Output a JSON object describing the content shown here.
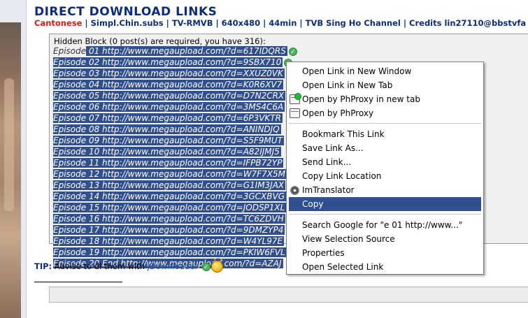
{
  "header": {
    "title": "DIRECT DOWNLOAD LINKS",
    "meta_lang": "Cantonese",
    "meta_rest": " | Simpl.Chin.subs | TV-RMVB | 640x480 | 44min | TVB Sing Ho Channel | Credits lin27110@bbstvfa"
  },
  "quote": {
    "hint": "Hidden Block (0 post(s) are required, you have 316):",
    "rows": [
      {
        "pre": "Episode",
        "sel": " 01 http://www.megaupload.com/?d=617IDQRS",
        "check": true
      },
      {
        "pre": "",
        "sel": "Episode 02 http://www.megaupload.com/?d=9SBX710",
        "check": true
      },
      {
        "pre": "",
        "sel": "Episode 03 http://www.megaupload.com/?d=XXUZ0VK",
        "check": false
      },
      {
        "pre": "",
        "sel": "Episode 04 http://www.megaupload.com/?d=K0R6XV7",
        "check": false
      },
      {
        "pre": "",
        "sel": "Episode 05 http://www.megaupload.com/?d=D7N2CRX",
        "check": false
      },
      {
        "pre": "",
        "sel": "Episode 06 http://www.megaupload.com/?d=3MS4C6A",
        "check": false
      },
      {
        "pre": "",
        "sel": "Episode 07 http://www.megaupload.com/?d=6P3VKTR",
        "check": false
      },
      {
        "pre": "",
        "sel": "Episode 08 http://www.megaupload.com/?d=ANINDJQ",
        "check": false
      },
      {
        "pre": "",
        "sel": "Episode 09 http://www.megaupload.com/?d=S5F9MUT",
        "check": false
      },
      {
        "pre": "",
        "sel": "Episode 10 http://www.megaupload.com/?d=A82IJMJ5",
        "check": false
      },
      {
        "pre": "",
        "sel": "Episode 11 http://www.megaupload.com/?d=IFPB72YP",
        "check": false
      },
      {
        "pre": "",
        "sel": "Episode 12 http://www.megaupload.com/?d=W7F7X5M",
        "check": false
      },
      {
        "pre": "",
        "sel": "Episode 13 http://www.megaupload.com/?d=G1IM3JAX",
        "check": false
      },
      {
        "pre": "",
        "sel": "Episode 14 http://www.megaupload.com/?d=3GCXBVG",
        "check": false
      },
      {
        "pre": "",
        "sel": "Episode 15 http://www.megaupload.com/?d=JODSP1XL",
        "check": false
      },
      {
        "pre": "",
        "sel": "Episode 16 http://www.megaupload.com/?d=TC6ZDVH",
        "check": false
      },
      {
        "pre": "",
        "sel": "Episode 17 http://www.megaupload.com/?d=9DMZYP4",
        "check": false
      },
      {
        "pre": "",
        "sel": "Episode 18 http://www.megaupload.com/?d=W4YL97E",
        "check": false
      },
      {
        "pre": "",
        "sel": "Episode 19 http://www.megaupload.com/?d=PKIW6FVL",
        "check": false
      },
      {
        "pre": "",
        "sel": "Episode 20 End http://www.megaupload.com/?d=AZAJ",
        "check": false
      }
    ]
  },
  "tip": {
    "label": "TIP:",
    "text": " Advise to dl them with ",
    "link": "JDownloader"
  },
  "context_menu": {
    "items": [
      {
        "label": "Open Link in New Window",
        "icon": ""
      },
      {
        "label": "Open Link in New Tab",
        "icon": ""
      },
      {
        "label": "Open by PhProxy in new tab",
        "icon": "phproxy-newtab-icon"
      },
      {
        "label": "Open by PhProxy",
        "icon": "phproxy-icon"
      },
      {
        "sep": true
      },
      {
        "label": "Bookmark This Link",
        "icon": ""
      },
      {
        "label": "Save Link As...",
        "icon": ""
      },
      {
        "label": "Send Link...",
        "icon": ""
      },
      {
        "label": "Copy Link Location",
        "icon": ""
      },
      {
        "label": "ImTranslator",
        "icon": "imtranslator-icon"
      },
      {
        "label": "Copy",
        "icon": "",
        "active": true
      },
      {
        "sep": true
      },
      {
        "label": "Search Google for \"e 01 http://www...\"",
        "icon": ""
      },
      {
        "label": "View Selection Source",
        "icon": ""
      },
      {
        "label": "Properties",
        "icon": ""
      },
      {
        "label": "Open Selected Link",
        "icon": ""
      }
    ]
  },
  "colors": {
    "header_blue": "#0b2d7c",
    "lang_red": "#e21313",
    "selection": "#2f4f8f",
    "link_blue": "#2d56b5"
  }
}
